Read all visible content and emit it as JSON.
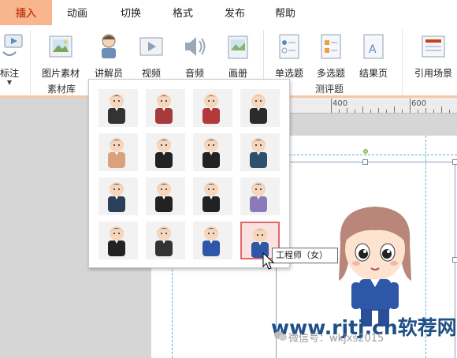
{
  "tabs": [
    {
      "label": "插入",
      "active": true
    },
    {
      "label": "动画",
      "active": false
    },
    {
      "label": "切换",
      "active": false
    },
    {
      "label": "格式",
      "active": false
    },
    {
      "label": "发布",
      "active": false
    },
    {
      "label": "帮助",
      "active": false
    }
  ],
  "ribbon": {
    "annotate": "标注",
    "image_material": "图片素材",
    "narrator": "讲解员",
    "video": "视频",
    "audio": "音频",
    "album": "画册",
    "material_library": "素材库",
    "single_choice": "单选题",
    "multiple_choice": "多选题",
    "result_page": "结果页",
    "quiz_group": "测评题",
    "reference_scene": "引用场景"
  },
  "ruler": {
    "mark_400": "400",
    "mark_600": "600"
  },
  "gallery": {
    "rows": 4,
    "columns": 4,
    "selected_index": 15,
    "tooltip": "工程师（女）"
  },
  "watermark": {
    "site": "www.rjtj.cn软荐网",
    "wechat": "微信号：wkjxs2015"
  },
  "colors": {
    "accent": "#c9401b",
    "active_tab_bg": "#f7b68d",
    "selection": "#e0686b",
    "guide": "#5fb0d8"
  }
}
